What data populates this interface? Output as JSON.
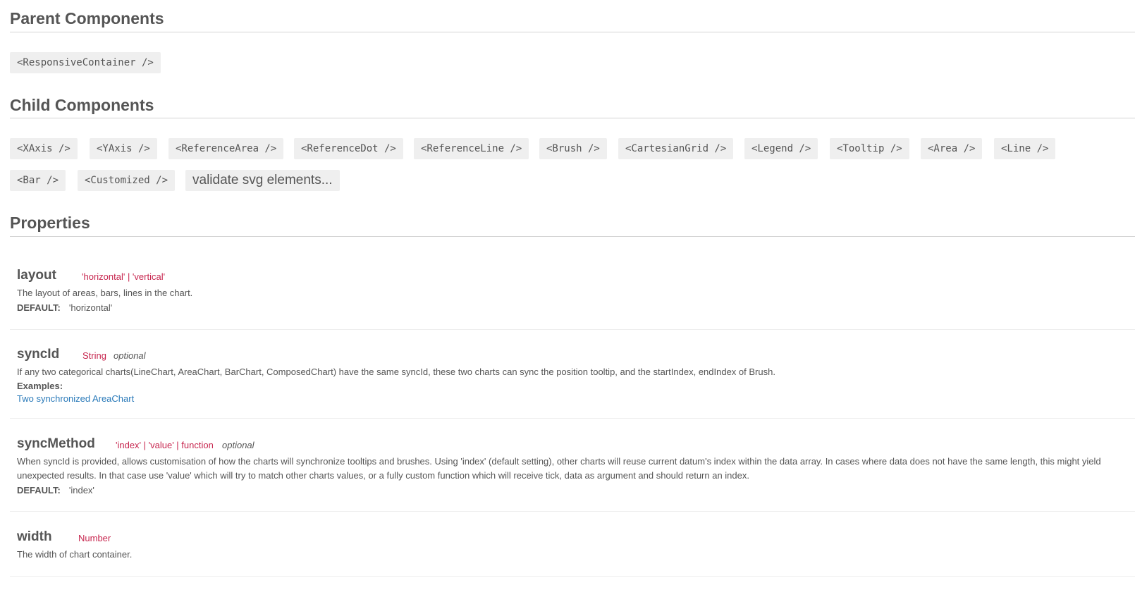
{
  "parent_section": {
    "title": "Parent Components",
    "items": [
      "<ResponsiveContainer />"
    ]
  },
  "child_section": {
    "title": "Child Components",
    "items": [
      "<XAxis />",
      "<YAxis />",
      "<ReferenceArea />",
      "<ReferenceDot />",
      "<ReferenceLine />",
      "<Brush />",
      "<CartesianGrid />",
      "<Legend />",
      "<Tooltip />",
      "<Area />",
      "<Line />",
      "<Bar />",
      "<Customized />"
    ],
    "validate_label": "validate svg elements..."
  },
  "properties_section": {
    "title": "Properties",
    "props": [
      {
        "name": "layout",
        "type": "'horizontal' | 'vertical'",
        "description": "The layout of areas, bars, lines in the chart.",
        "default_label": "DEFAULT:",
        "default_value": "'horizontal'"
      },
      {
        "name": "syncId",
        "type": "String",
        "optional": "optional",
        "description": "If any two categorical charts(LineChart, AreaChart, BarChart, ComposedChart) have the same syncId, these two charts can sync the position tooltip, and the startIndex, endIndex of Brush.",
        "examples_label": "Examples:",
        "example_link": "Two synchronized AreaChart"
      },
      {
        "name": "syncMethod",
        "type": "'index' | 'value' | function",
        "optional": "optional",
        "description": "When syncId is provided, allows customisation of how the charts will synchronize tooltips and brushes. Using 'index' (default setting), other charts will reuse current datum's index within the data array. In cases where data does not have the same length, this might yield unexpected results. In that case use 'value' which will try to match other charts values, or a fully custom function which will receive tick, data as argument and should return an index.",
        "default_label": "DEFAULT:",
        "default_value": "'index'"
      },
      {
        "name": "width",
        "type": "Number",
        "description": "The width of chart container."
      }
    ]
  }
}
